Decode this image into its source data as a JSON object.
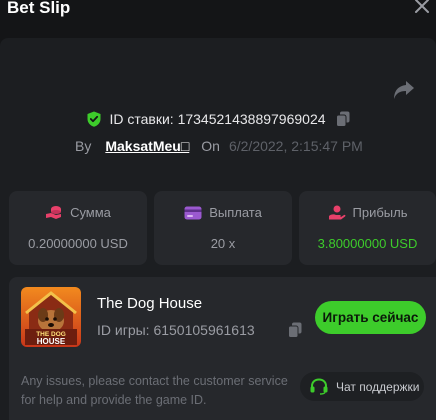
{
  "header": {
    "title": "Bet Slip",
    "close_icon": "close-icon"
  },
  "bet": {
    "id_text": "ID ставки: 1734521438897969024",
    "by_label": "By",
    "username": "MaksatMeu□",
    "on_label": "On",
    "date": "6/2/2022, 2:15:47 PM"
  },
  "stats": {
    "amount": {
      "label": "Сумма",
      "value": "0.20000000 USD",
      "icon": "coins-icon"
    },
    "payout": {
      "label": "Выплата",
      "value": "20 x",
      "icon": "card-icon"
    },
    "profit": {
      "label": "Прибыль",
      "value": "3.80000000 USD",
      "icon": "profit-hand-icon"
    }
  },
  "game": {
    "name": "The Dog House",
    "id_text": "ID игры: 6150105961613",
    "thumb_title_1": "THE DOG",
    "thumb_title_2": "HOUSE",
    "play_label": "Играть сейчас"
  },
  "help": {
    "text": "Any issues, please contact the customer service for help and provide the game ID.",
    "support_label": "Чат поддержки"
  },
  "colors": {
    "accent_green": "#3dcc2b",
    "background": "#141517",
    "panel": "#1c1e21",
    "card": "#26282c"
  }
}
